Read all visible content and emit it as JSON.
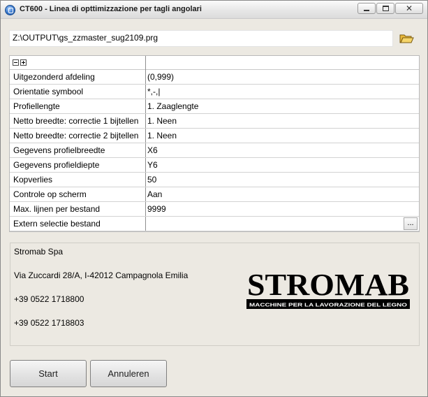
{
  "window": {
    "title": "CT600 - Linea di opttimizzazione per tagli angolari"
  },
  "file": {
    "path": "Z:\\OUTPUT\\gs_zzmaster_sug2109.prg"
  },
  "properties": [
    {
      "label": "Uitgezonderd afdeling",
      "value": "(0,999)"
    },
    {
      "label": "Orientatie symbool",
      "value": "*,-,|"
    },
    {
      "label": "Profiellengte",
      "value": "1. Zaaglengte"
    },
    {
      "label": "Netto breedte: correctie 1 bijtellen",
      "value": "1. Neen"
    },
    {
      "label": "Netto breedte: correctie 2 bijtellen",
      "value": "1. Neen"
    },
    {
      "label": "Gegevens profielbreedte",
      "value": "X6"
    },
    {
      "label": "Gegevens profieldiepte",
      "value": "Y6"
    },
    {
      "label": "Kopverlies",
      "value": "50"
    },
    {
      "label": "Controle op scherm",
      "value": "Aan"
    },
    {
      "label": "Max. lijnen per bestand",
      "value": "9999"
    },
    {
      "label": "Extern selectie bestand",
      "value": ""
    }
  ],
  "ellipsis_label": "...",
  "company": {
    "name": "Stromab Spa",
    "address": "Via Zuccardi 28/A, I-42012 Campagnola Emilia",
    "phone": "+39 0522 1718800",
    "fax": "+39 0522 1718803",
    "logo_text": "STROMAB",
    "logo_tagline": "MACCHINE PER LA LAVORAZIONE DEL LEGNO"
  },
  "buttons": {
    "start": "Start",
    "cancel": "Annuleren"
  }
}
